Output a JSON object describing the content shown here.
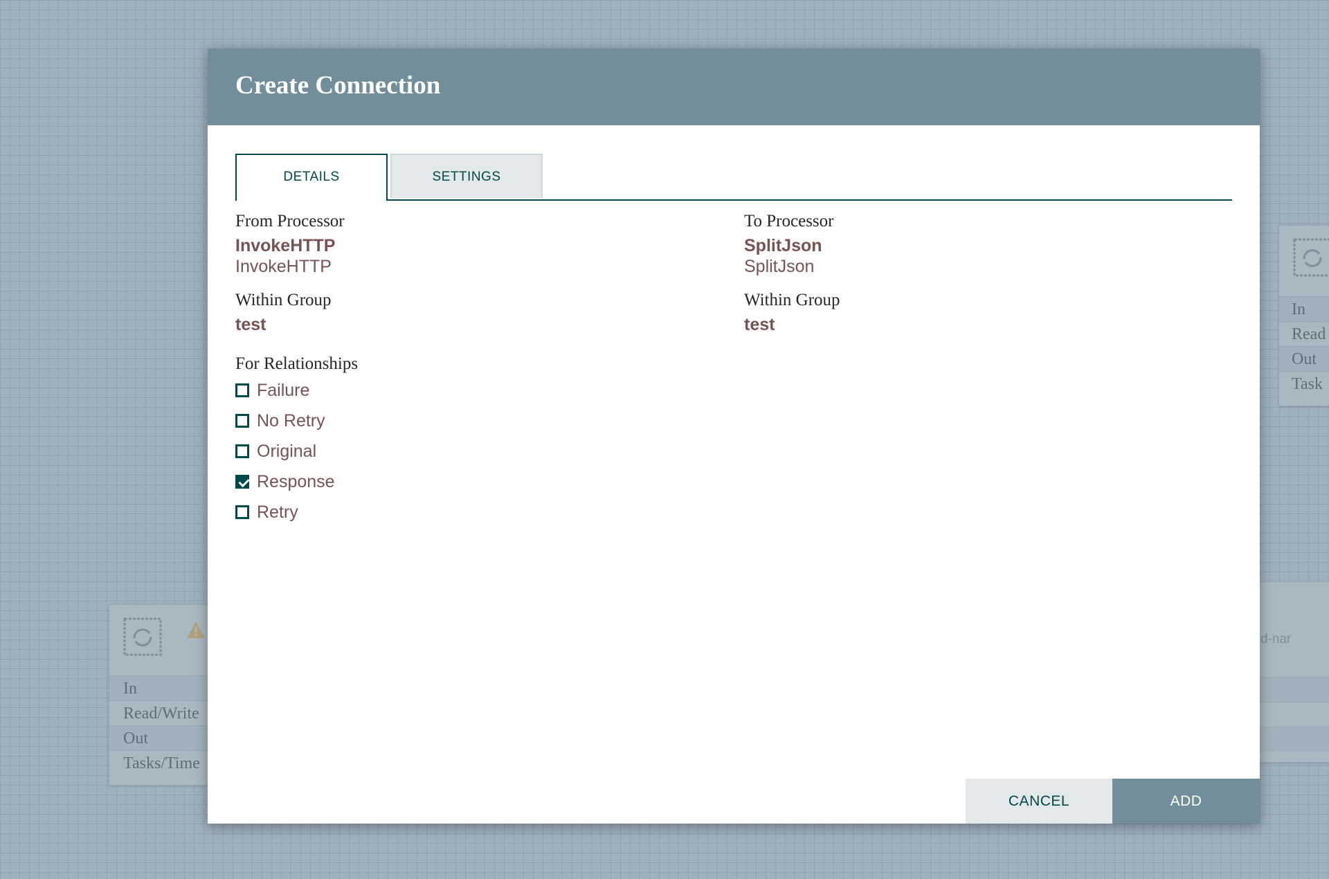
{
  "background": {
    "left_processor": {
      "rows": [
        "In",
        "Read/Write",
        "Out",
        "Tasks/Time"
      ]
    },
    "right_processor_top": {
      "rows": [
        "In",
        "Read",
        "Out",
        "Task"
      ]
    },
    "right_processor_bottom": {
      "text": "d-nar"
    }
  },
  "dialog": {
    "title": "Create Connection",
    "tabs": [
      {
        "label": "DETAILS",
        "active": true
      },
      {
        "label": "SETTINGS",
        "active": false
      }
    ],
    "from": {
      "label": "From Processor",
      "name": "InvokeHTTP",
      "type": "InvokeHTTP",
      "group_label": "Within Group",
      "group": "test"
    },
    "to": {
      "label": "To Processor",
      "name": "SplitJson",
      "type": "SplitJson",
      "group_label": "Within Group",
      "group": "test"
    },
    "relationships": {
      "label": "For Relationships",
      "items": [
        {
          "label": "Failure",
          "checked": false
        },
        {
          "label": "No Retry",
          "checked": false
        },
        {
          "label": "Original",
          "checked": false
        },
        {
          "label": "Response",
          "checked": true
        },
        {
          "label": "Retry",
          "checked": false
        }
      ]
    },
    "buttons": {
      "cancel": "CANCEL",
      "add": "ADD"
    }
  },
  "colors": {
    "header": "#728e9b",
    "accent": "#004849",
    "value_text": "#775351"
  }
}
